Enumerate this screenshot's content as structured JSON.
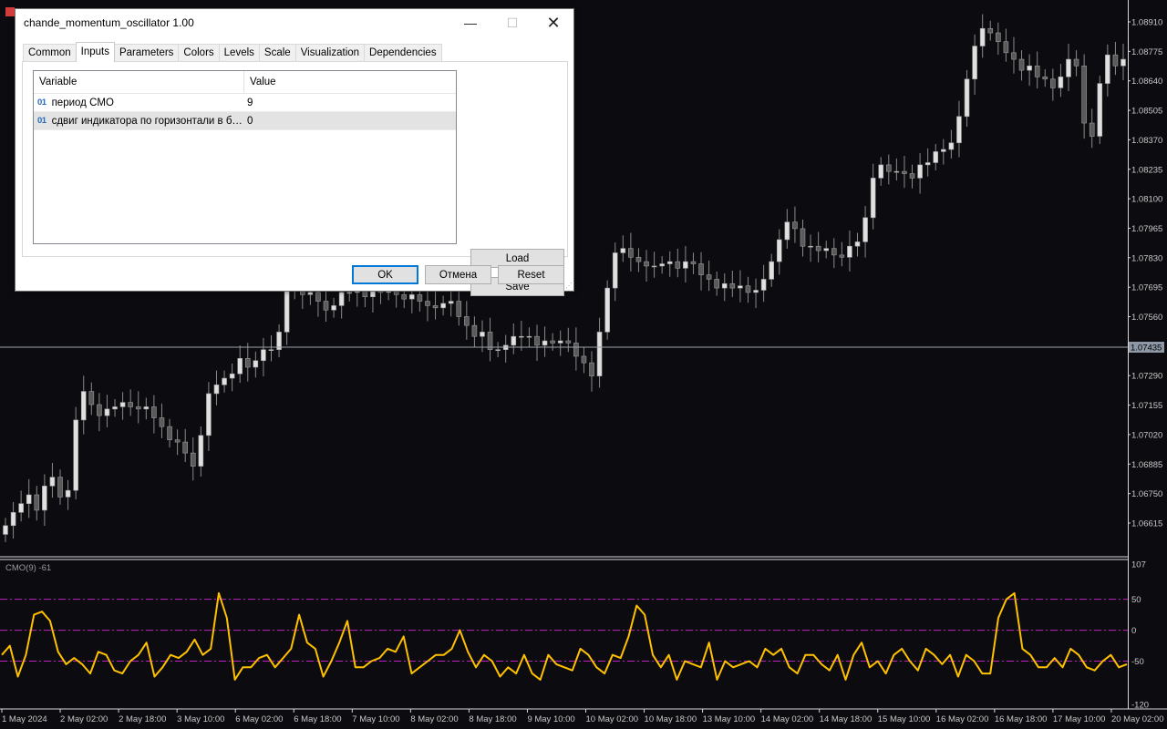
{
  "dialog": {
    "title": "chande_momentum_oscillator 1.00",
    "tabs": [
      "Common",
      "Inputs",
      "Parameters",
      "Colors",
      "Levels",
      "Scale",
      "Visualization",
      "Dependencies"
    ],
    "active_tab": "Inputs",
    "grid": {
      "headers": [
        "Variable",
        "Value"
      ],
      "rows": [
        {
          "type_icon": "01",
          "variable": "период CMO",
          "value": "9"
        },
        {
          "type_icon": "01",
          "variable": "сдвиг индикатора по горизонтали в б…",
          "value": "0"
        }
      ],
      "selected_row": 1
    },
    "buttons": {
      "load": "Load",
      "save": "Save",
      "ok": "OK",
      "cancel": "Отмена",
      "reset": "Reset"
    }
  },
  "price_axis": {
    "labels": [
      "1.08910",
      "1.08775",
      "1.08640",
      "1.08505",
      "1.08370",
      "1.08235",
      "1.08100",
      "1.07965",
      "1.07830",
      "1.07695",
      "1.07560",
      "1.07425",
      "1.07290",
      "1.07155",
      "1.07020",
      "1.06885",
      "1.06750",
      "1.06615"
    ],
    "current_price": "1.07435"
  },
  "indicator": {
    "label": "CMO(9) -61",
    "scale_labels": [
      "107",
      "50",
      "0",
      "-50",
      "-120"
    ],
    "levels": [
      50,
      0,
      -50
    ],
    "level_color": "#c020c0",
    "line_color": "#ffc000"
  },
  "time_axis": {
    "labels": [
      "1 May 2024",
      "2 May 02:00",
      "2 May 18:00",
      "3 May 10:00",
      "6 May 02:00",
      "6 May 18:00",
      "7 May 10:00",
      "8 May 02:00",
      "8 May 18:00",
      "9 May 10:00",
      "10 May 02:00",
      "10 May 18:00",
      "13 May 10:00",
      "14 May 02:00",
      "14 May 18:00",
      "15 May 10:00",
      "16 May 02:00",
      "16 May 18:00",
      "17 May 10:00",
      "20 May 02:00"
    ]
  },
  "chart_data": [
    {
      "type": "candlestick",
      "title": "",
      "y_unit": "price",
      "ylim": [
        1.0654,
        1.0898
      ],
      "close": [
        1.0662,
        1.0668,
        1.0672,
        1.0676,
        1.0669,
        1.068,
        1.0684,
        1.0675,
        1.0678,
        1.071,
        1.0723,
        1.0717,
        1.0712,
        1.0715,
        1.0716,
        1.0718,
        1.0716,
        1.0715,
        1.0716,
        1.0711,
        1.0707,
        1.0701,
        1.07,
        1.0695,
        1.0689,
        1.0703,
        1.0722,
        1.0726,
        1.0729,
        1.0731,
        1.0738,
        1.0734,
        1.0737,
        1.0742,
        1.0742,
        1.075,
        1.0769,
        1.077,
        1.0767,
        1.0768,
        1.0764,
        1.076,
        1.0762,
        1.0768,
        1.0768,
        1.0771,
        1.0766,
        1.0769,
        1.0768,
        1.077,
        1.0767,
        1.0765,
        1.0767,
        1.0764,
        1.0762,
        1.0761,
        1.0763,
        1.0764,
        1.0757,
        1.0753,
        1.0748,
        1.075,
        1.0742,
        1.0742,
        1.0744,
        1.0748,
        1.0748,
        1.0748,
        1.0744,
        1.0746,
        1.0745,
        1.0746,
        1.0745,
        1.0739,
        1.0736,
        1.073,
        1.075,
        1.077,
        1.0786,
        1.0788,
        1.0784,
        1.0782,
        1.078,
        1.078,
        1.0781,
        1.0782,
        1.0779,
        1.0782,
        1.0781,
        1.0776,
        1.0774,
        1.077,
        1.0772,
        1.077,
        1.0771,
        1.0768,
        1.0769,
        1.0774,
        1.0782,
        1.0792,
        1.08,
        1.0797,
        1.0789,
        1.0789,
        1.0787,
        1.0788,
        1.0785,
        1.0784,
        1.0789,
        1.0791,
        1.0802,
        1.082,
        1.0826,
        1.0823,
        1.0823,
        1.0822,
        1.082,
        1.0826,
        1.0827,
        1.0832,
        1.0833,
        1.0836,
        1.0848,
        1.0865,
        1.088,
        1.0888,
        1.0886,
        1.0882,
        1.0877,
        1.0874,
        1.0869,
        1.0871,
        1.0866,
        1.0865,
        1.0861,
        1.0866,
        1.0874,
        1.0871,
        1.0845,
        1.0839,
        1.0863,
        1.0876,
        1.0871,
        1.0874
      ]
    },
    {
      "type": "line",
      "title": "",
      "series_name": "CMO(9)",
      "ylim": [
        -120,
        107
      ],
      "values": [
        -40,
        -25,
        -75,
        -40,
        25,
        30,
        15,
        -35,
        -55,
        -45,
        -55,
        -70,
        -35,
        -40,
        -65,
        -70,
        -50,
        -40,
        -20,
        -75,
        -60,
        -40,
        -45,
        -35,
        -15,
        -40,
        -30,
        60,
        20,
        -80,
        -60,
        -60,
        -45,
        -40,
        -60,
        -45,
        -30,
        25,
        -20,
        -30,
        -75,
        -50,
        -20,
        15,
        -60,
        -60,
        -50,
        -45,
        -30,
        -35,
        -10,
        -70,
        -60,
        -50,
        -40,
        -40,
        -30,
        0,
        -35,
        -60,
        -40,
        -50,
        -75,
        -60,
        -70,
        -40,
        -70,
        -80,
        -40,
        -55,
        -60,
        -65,
        -30,
        -40,
        -60,
        -70,
        -40,
        -45,
        -10,
        40,
        25,
        -40,
        -60,
        -40,
        -80,
        -50,
        -55,
        -60,
        -20,
        -80,
        -50,
        -60,
        -55,
        -50,
        -60,
        -30,
        -40,
        -30,
        -60,
        -70,
        -40,
        -40,
        -55,
        -65,
        -40,
        -80,
        -40,
        -20,
        -60,
        -50,
        -70,
        -40,
        -30,
        -50,
        -65,
        -30,
        -40,
        -55,
        -40,
        -75,
        -40,
        -50,
        -70,
        -70,
        20,
        50,
        60,
        -30,
        -40,
        -60,
        -60,
        -45,
        -60,
        -30,
        -40,
        -60,
        -65,
        -50,
        -40,
        -60,
        -55
      ]
    }
  ]
}
